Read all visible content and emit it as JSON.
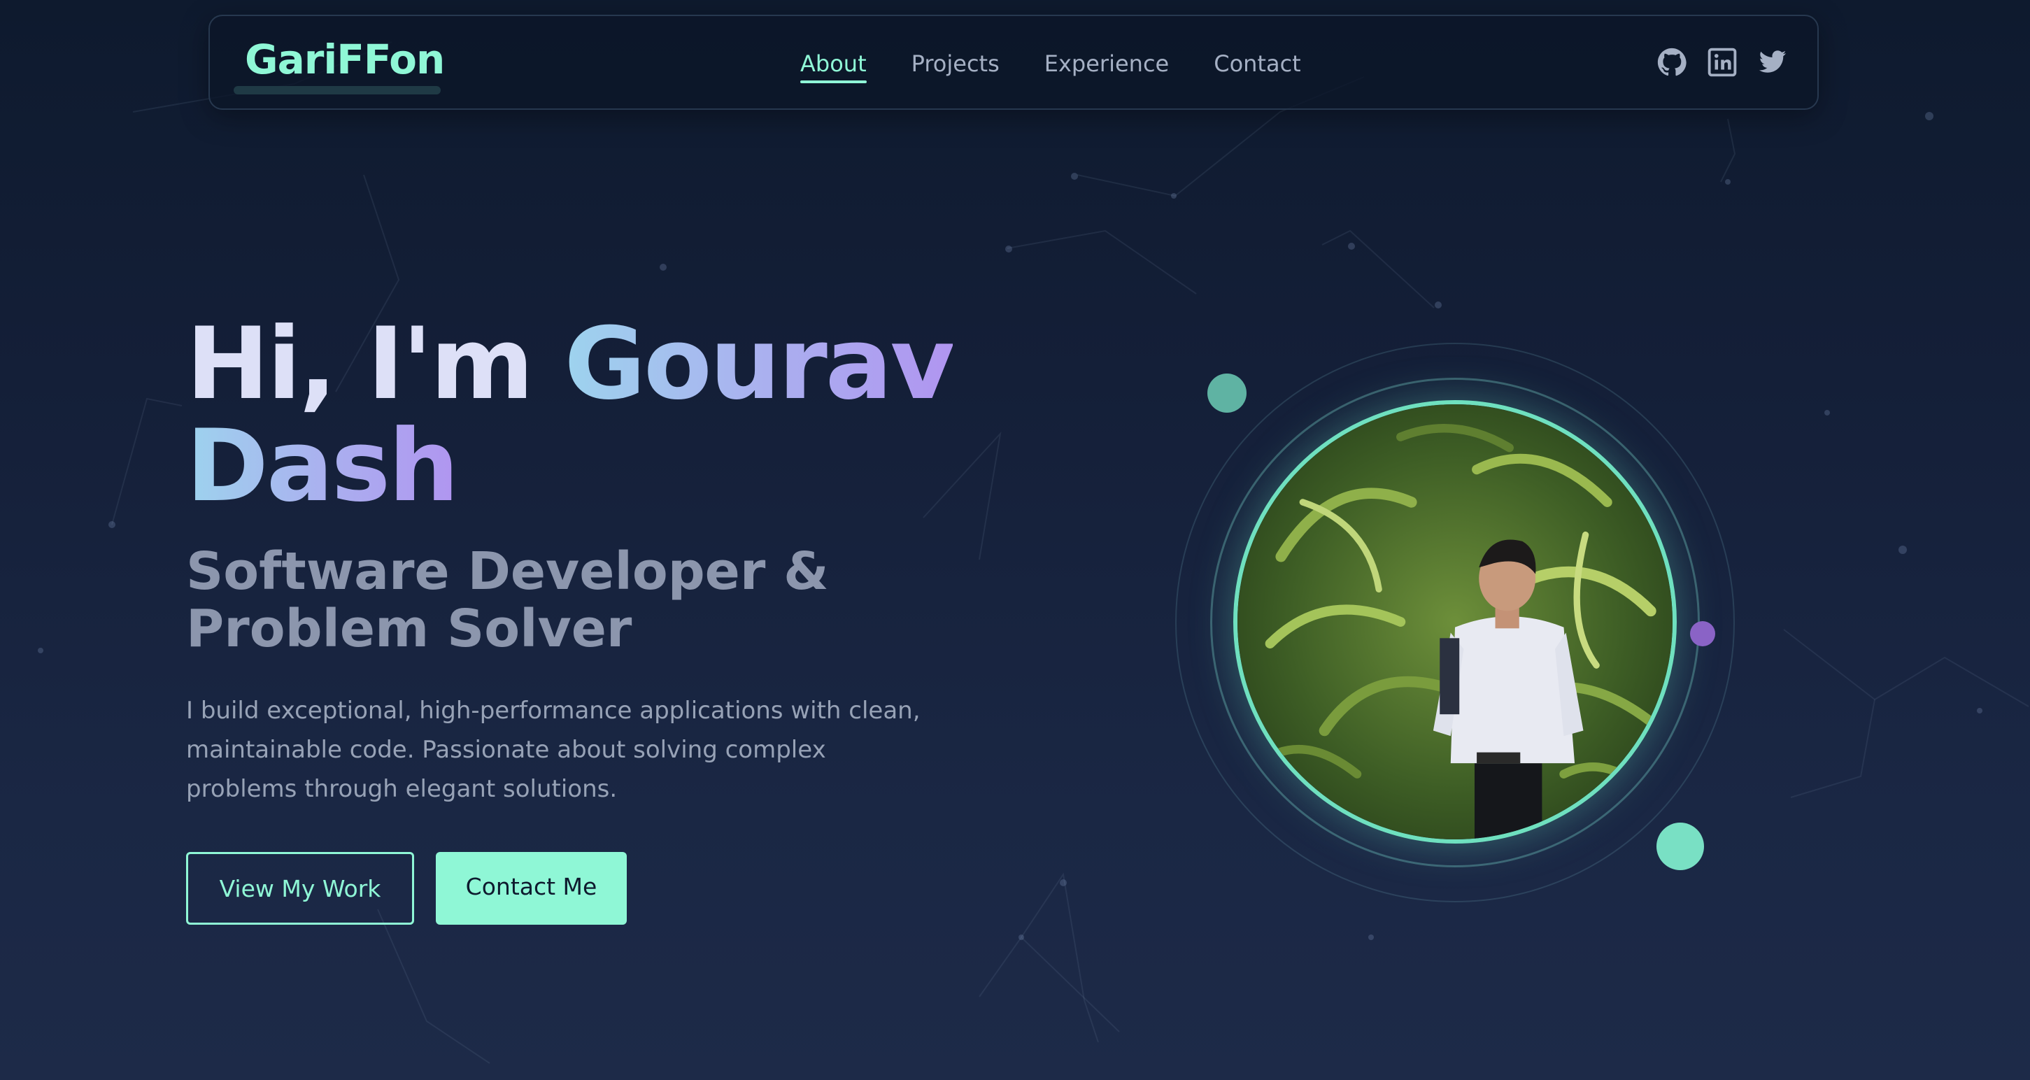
{
  "nav": {
    "logo": "GariFFon",
    "links": [
      "About",
      "Projects",
      "Experience",
      "Contact"
    ],
    "active": "About",
    "social_icons": [
      "github-icon",
      "linkedin-icon",
      "twitter-icon"
    ]
  },
  "hero": {
    "greeting": "Hi, I'm ",
    "name_first": "Gourav",
    "name_last": "Dash",
    "subtitle_line1": "Software Developer &",
    "subtitle_line2": "Problem Solver",
    "description": "I build exceptional, high-performance applications with clean, maintainable code. Passionate about solving complex problems through elegant solutions.",
    "primary_button": "View My Work",
    "secondary_button": "Contact Me"
  },
  "colors": {
    "accent": "#8ff7d6",
    "background": "#141f38",
    "heading": "#dde0f7",
    "muted": "#8c96ad",
    "purple_accent": "#8a63c6"
  }
}
